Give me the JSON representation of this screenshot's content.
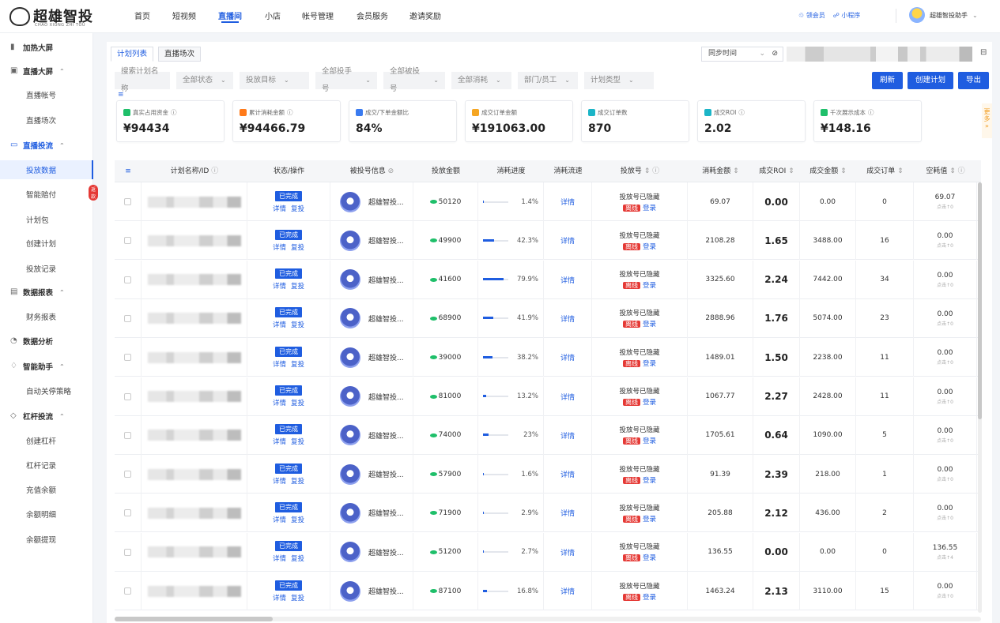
{
  "brand": {
    "title": "超雄智投",
    "subtitle": "CHAO XIONG ZHI TOU"
  },
  "nav": [
    "首页",
    "短视频",
    "直播间",
    "小店",
    "帐号管理",
    "会员服务",
    "邀请奖励"
  ],
  "nav_active": "直播间",
  "toplinks": {
    "vip": "领会员",
    "mini": "小程序"
  },
  "user": {
    "name": "超雄智投助手"
  },
  "sidebar": {
    "items": [
      {
        "label": "加热大屏",
        "type": "head",
        "icon": "bar-chart-icon"
      },
      {
        "label": "直播大屏",
        "type": "head",
        "icon": "tv-icon",
        "chev": "^"
      },
      {
        "label": "直播帐号",
        "type": "sub"
      },
      {
        "label": "直播场次",
        "type": "sub"
      },
      {
        "label": "直播投流",
        "type": "head",
        "icon": "monitor-icon",
        "chev": "^",
        "active_head": true
      },
      {
        "label": "投放数据",
        "type": "sub",
        "active": true
      },
      {
        "label": "智能赔付",
        "type": "sub",
        "badge": "返款"
      },
      {
        "label": "计划包",
        "type": "sub"
      },
      {
        "label": "创建计划",
        "type": "sub"
      },
      {
        "label": "投放记录",
        "type": "sub"
      },
      {
        "label": "数据报表",
        "type": "head",
        "icon": "calendar-icon",
        "chev": "^"
      },
      {
        "label": "财务报表",
        "type": "sub"
      },
      {
        "label": "数据分析",
        "type": "head",
        "icon": "analysis-icon"
      },
      {
        "label": "智能助手",
        "type": "head",
        "icon": "thumb-icon",
        "chev": "^"
      },
      {
        "label": "自动关停策略",
        "type": "sub"
      },
      {
        "label": "杠杆投流",
        "type": "head",
        "icon": "lever-icon",
        "chev": "^"
      },
      {
        "label": "创建杠杆",
        "type": "sub"
      },
      {
        "label": "杠杆记录",
        "type": "sub"
      },
      {
        "label": "充值余额",
        "type": "sub"
      },
      {
        "label": "余额明细",
        "type": "sub"
      },
      {
        "label": "余额提现",
        "type": "sub"
      }
    ]
  },
  "tabs": [
    "计划列表",
    "直播场次"
  ],
  "sync": {
    "label": "同步时间"
  },
  "filters": [
    "搜索计划名称",
    "全部状态",
    "投放目标",
    "全部投手号",
    "全部被投号",
    "全部消耗",
    "部门/员工",
    "计划类型"
  ],
  "buttons": {
    "refresh": "刷新",
    "create": "创建计划",
    "export": "导出"
  },
  "stats": [
    {
      "label": "真实占用资金",
      "value": "¥94434",
      "color": "#1fbf6a"
    },
    {
      "label": "累计消耗金额",
      "value": "¥94466.79",
      "color": "#ff7a1a"
    },
    {
      "label": "成交/下单金额比",
      "value": "84%",
      "color": "#3a7bf0"
    },
    {
      "label": "成交订单金额",
      "value": "¥191063.00",
      "color": "#f5a623"
    },
    {
      "label": "成交订单数",
      "value": "870",
      "color": "#1cb5c7"
    },
    {
      "label": "成交ROI",
      "value": "2.02",
      "color": "#1cb5c7"
    },
    {
      "label": "千次展示成本",
      "value": "¥148.16",
      "color": "#1fbf6a"
    }
  ],
  "more_label": "更多",
  "columns": [
    "计划名称/ID",
    "状态/操作",
    "被投号信息",
    "投放金额",
    "消耗进度",
    "消耗流速",
    "投放号",
    "消耗金额",
    "成交ROI",
    "成交金额",
    "成交订单",
    "空耗值"
  ],
  "row_const": {
    "status": "已完成",
    "detail": "详情",
    "repeat": "复投",
    "account": "超雄智投...",
    "hidden": "投放号已隐藏",
    "offline": "离线",
    "login": "登录"
  },
  "rows": [
    {
      "amount": "50120",
      "progress": 1.4,
      "ptxt": "1.4%",
      "spend": "69.07",
      "roi": "0.00",
      "gmv": "0.00",
      "orders": "0",
      "empty": "69.07",
      "empty_sub": "点击↑0"
    },
    {
      "amount": "49900",
      "progress": 42.3,
      "ptxt": "42.3%",
      "spend": "2108.28",
      "roi": "1.65",
      "gmv": "3488.00",
      "orders": "16",
      "empty": "0.00",
      "empty_sub": "点击↑0"
    },
    {
      "amount": "41600",
      "progress": 79.9,
      "ptxt": "79.9%",
      "spend": "3325.60",
      "roi": "2.24",
      "gmv": "7442.00",
      "orders": "34",
      "empty": "0.00",
      "empty_sub": "点击↑0"
    },
    {
      "amount": "68900",
      "progress": 41.9,
      "ptxt": "41.9%",
      "spend": "2888.96",
      "roi": "1.76",
      "gmv": "5074.00",
      "orders": "23",
      "empty": "0.00",
      "empty_sub": "点击↑0"
    },
    {
      "amount": "39000",
      "progress": 38.2,
      "ptxt": "38.2%",
      "spend": "1489.01",
      "roi": "1.50",
      "gmv": "2238.00",
      "orders": "11",
      "empty": "0.00",
      "empty_sub": "点击↑0"
    },
    {
      "amount": "81000",
      "progress": 13.2,
      "ptxt": "13.2%",
      "spend": "1067.77",
      "roi": "2.27",
      "gmv": "2428.00",
      "orders": "11",
      "empty": "0.00",
      "empty_sub": "点击↑0"
    },
    {
      "amount": "74000",
      "progress": 23,
      "ptxt": "23%",
      "spend": "1705.61",
      "roi": "0.64",
      "gmv": "1090.00",
      "orders": "5",
      "empty": "0.00",
      "empty_sub": "点击↑0"
    },
    {
      "amount": "57900",
      "progress": 1.6,
      "ptxt": "1.6%",
      "spend": "91.39",
      "roi": "2.39",
      "gmv": "218.00",
      "orders": "1",
      "empty": "0.00",
      "empty_sub": "点击↑0"
    },
    {
      "amount": "71900",
      "progress": 2.9,
      "ptxt": "2.9%",
      "spend": "205.88",
      "roi": "2.12",
      "gmv": "436.00",
      "orders": "2",
      "empty": "0.00",
      "empty_sub": "点击↑0"
    },
    {
      "amount": "51200",
      "progress": 2.7,
      "ptxt": "2.7%",
      "spend": "136.55",
      "roi": "0.00",
      "gmv": "0.00",
      "orders": "0",
      "empty": "136.55",
      "empty_sub": "点击↑4"
    },
    {
      "amount": "87100",
      "progress": 16.8,
      "ptxt": "16.8%",
      "spend": "1463.24",
      "roi": "2.13",
      "gmv": "3110.00",
      "orders": "15",
      "empty": "0.00",
      "empty_sub": "点击↑0"
    }
  ]
}
